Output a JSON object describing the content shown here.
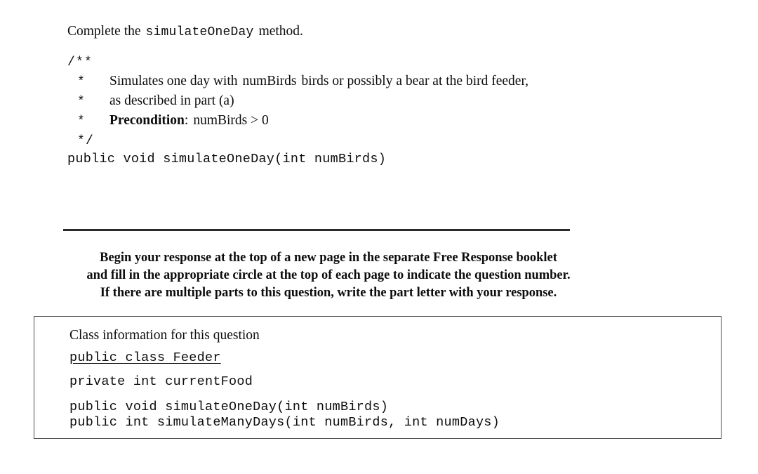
{
  "document": {
    "intro": {
      "prefix": "Complete the",
      "method_name": "simulateOneDay",
      "suffix": "method."
    },
    "javadoc": {
      "open_marker": "/**",
      "close_marker": "*/",
      "star_marker": "*",
      "lines": [
        {
          "text_before": "Simulates one day with",
          "code": "numBirds",
          "text_after": "birds or possibly a bear at the bird feeder,"
        },
        {
          "text_before": "as described in part (a)",
          "code": "",
          "text_after": ""
        },
        {
          "label": "Precondition",
          "label_suffix": ":",
          "code": "numBirds > 0"
        }
      ]
    },
    "method_signature": "public void simulateOneDay(int numBirds)",
    "instructions": [
      "Begin your response at the top of a new page in the separate Free Response booklet",
      "and fill in the appropriate circle at the top of each page to indicate the question number.",
      "If there are multiple parts to this question, write the part letter with your response."
    ],
    "class_box": {
      "title": "Class information for this question",
      "class_declaration": "public class Feeder",
      "field": "private int currentFood",
      "methods": [
        "public void simulateOneDay(int numBirds)",
        "public int simulateManyDays(int numBirds, int numDays)"
      ]
    }
  }
}
